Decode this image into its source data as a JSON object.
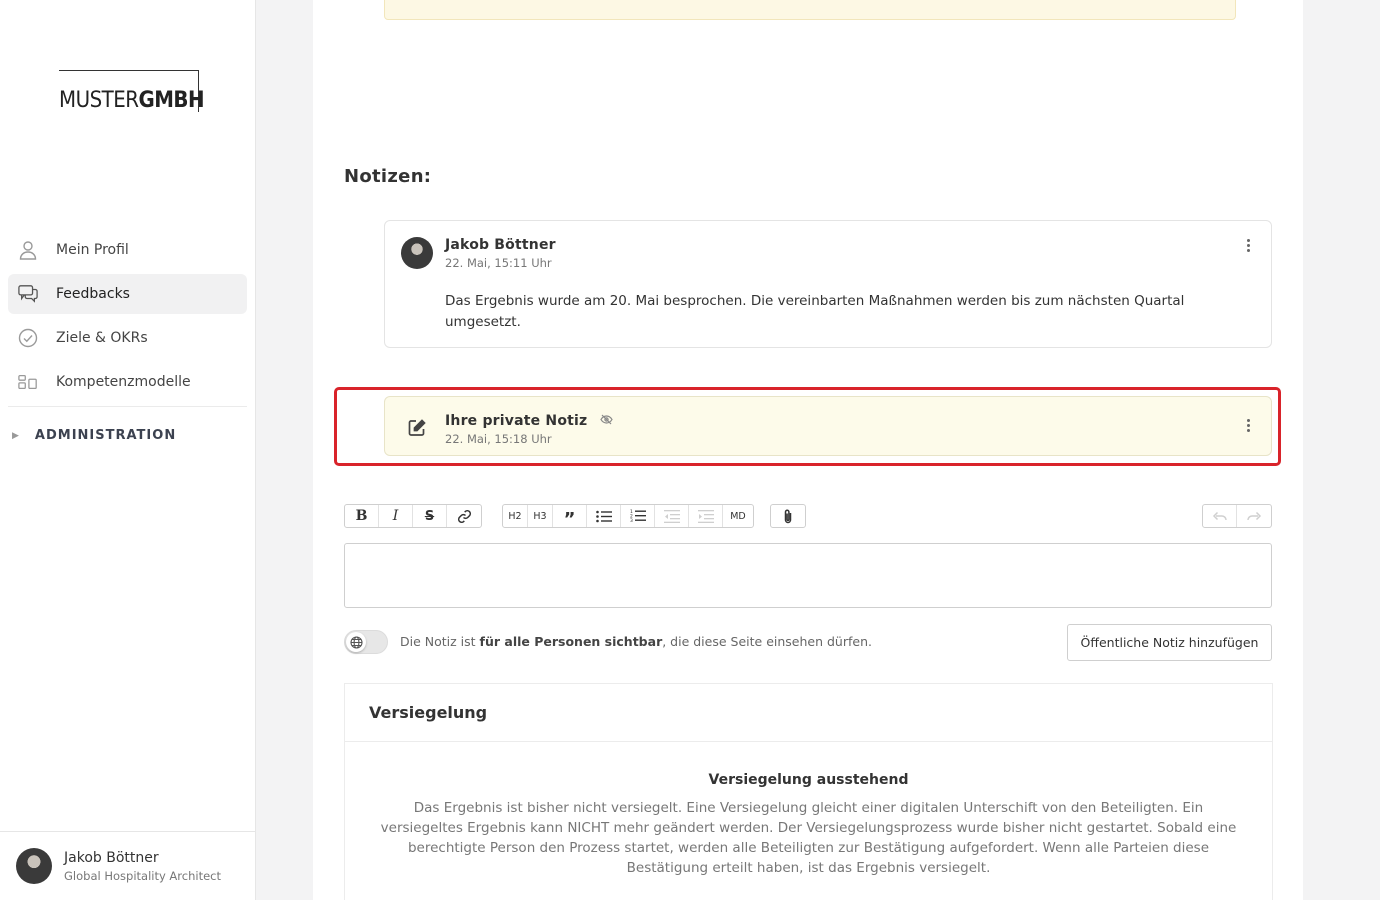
{
  "brand": {
    "logo_part1": "MUSTER",
    "logo_part2": "GMBH"
  },
  "sidebar": {
    "items": [
      {
        "label": "Mein Profil",
        "icon": "user-icon",
        "active": false
      },
      {
        "label": "Feedbacks",
        "icon": "chat-icon",
        "active": true
      },
      {
        "label": "Ziele & OKRs",
        "icon": "check-circle-icon",
        "active": false
      },
      {
        "label": "Kompetenzmodelle",
        "icon": "model-icon",
        "active": false
      }
    ],
    "admin_label": "ADMINISTRATION",
    "user": {
      "name": "Jakob Böttner",
      "role": "Global Hospitality Architect"
    }
  },
  "notes": {
    "title": "Notizen:",
    "items": [
      {
        "author": "Jakob Böttner",
        "time": "22. Mai, 15:11 Uhr",
        "body": "Das Ergebnis wurde am 20. Mai besprochen. Die vereinbarten Maßnahmen werden bis zum nächsten Quartal umgesetzt."
      },
      {
        "author": "Ihre private Notiz",
        "time": "22. Mai, 15:18 Uhr"
      }
    ]
  },
  "editor": {
    "toolbar": {
      "h2": "H2",
      "h3": "H3",
      "md": "MD"
    },
    "visibility_pre": "Die Notiz ist ",
    "visibility_bold": "für alle Personen sichtbar",
    "visibility_post": ", die diese Seite einsehen dürfen.",
    "submit_label": "Öffentliche Notiz hinzufügen"
  },
  "seal": {
    "heading": "Versiegelung",
    "status_title": "Versiegelung ausstehend",
    "status_text": "Das Ergebnis ist bisher nicht versiegelt. Eine Versiegelung gleicht einer digitalen Unterschift von den Beteiligten. Ein versiegeltes Ergebnis kann NICHT mehr geändert werden. Der Versiegelungsprozess wurde bisher nicht gestartet. Sobald eine berechtigte Person den Prozess startet, werden alle Beteiligten zur Bestätigung aufgefordert. Wenn alle Parteien diese Bestätigung erteilt haben, ist das Ergebnis versiegelt."
  },
  "colors": {
    "highlight": "#d9232a",
    "private_note_bg": "#fdfbea",
    "warning_bg": "#fdf8e4"
  }
}
